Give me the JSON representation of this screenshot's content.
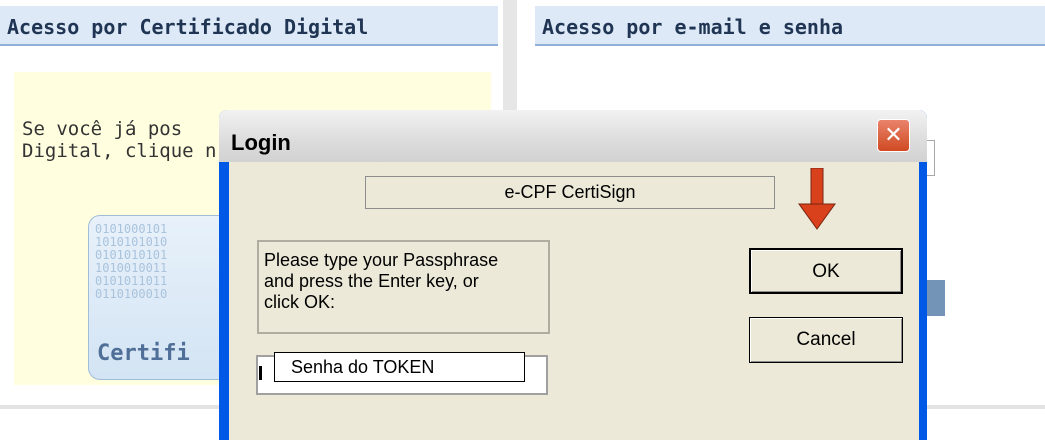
{
  "left_panel": {
    "heading": "Acesso por Certificado Digital",
    "text_line1": "Se você já pos",
    "text_line2": "Digital, clique n",
    "card_digits": "0101000101\n1010101010\n0101010101\n1010010011\n0101011011\n0110100010",
    "card_word": "Certifi"
  },
  "right_panel": {
    "heading": "Acesso por e-mail e senha"
  },
  "dialog": {
    "title": "Login",
    "close_glyph": "✕",
    "token_name": "e-CPF CertiSign",
    "message": "Please type your Passphrase\nand press the Enter key, or\nclick OK:",
    "callout": "Senha do TOKEN",
    "ok_label": "OK",
    "cancel_label": "Cancel",
    "arrow_color": "#d9401c"
  }
}
